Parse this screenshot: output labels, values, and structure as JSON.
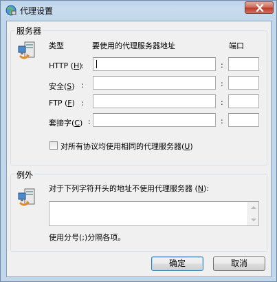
{
  "window": {
    "title": "代理设置"
  },
  "servers": {
    "group_label": "服务器",
    "col_type": "类型",
    "col_address": "要使用的代理服务器地址",
    "col_port": "端口",
    "rows": [
      {
        "label": "HTTP",
        "hotkey": "H",
        "colon": ":",
        "address": "",
        "port": ""
      },
      {
        "label": "安全",
        "hotkey": "S",
        "colon": ":",
        "address": "",
        "port": ""
      },
      {
        "label": "FTP",
        "hotkey": "F",
        "colon": ":",
        "address": "",
        "port": ""
      },
      {
        "label": "套接字",
        "hotkey": "C",
        "colon": ":",
        "address": "",
        "port": ""
      }
    ],
    "same_proxy_label": "对所有协议均使用相同的代理服务器",
    "same_proxy_hotkey": "U",
    "same_proxy_checked": false
  },
  "exceptions": {
    "group_label": "例外",
    "instruction": "对于下列字符开头的地址不使用代理服务器",
    "instruction_hotkey": "N",
    "value": "",
    "hint": "使用分号(;)分隔各项。"
  },
  "buttons": {
    "ok": "确定",
    "cancel": "取消"
  }
}
